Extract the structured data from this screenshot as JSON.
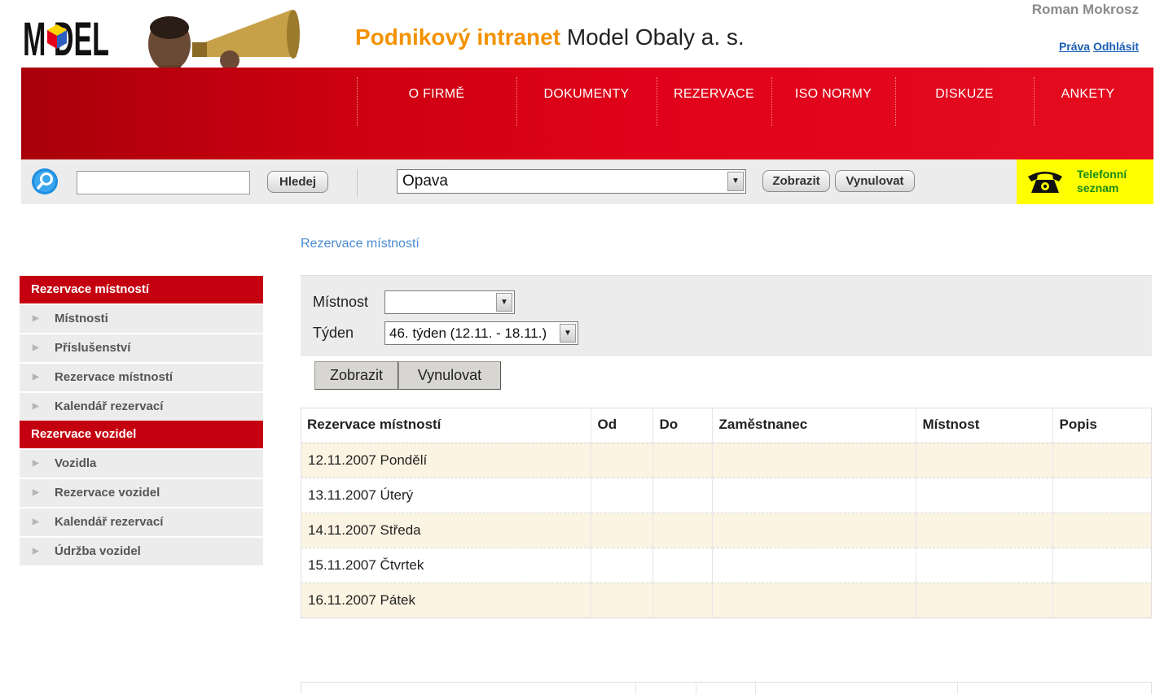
{
  "header": {
    "logo_text": "MODEL",
    "title_part1": "Podnikový intranet",
    "title_part2": "Model Obaly a. s.",
    "user_name": "Roman Mokrosz",
    "link_rights": "Práva",
    "link_logout": "Odhlásit"
  },
  "nav": {
    "items": [
      {
        "label": "O FIRMĚ"
      },
      {
        "label": "DOKUMENTY"
      },
      {
        "label": "REZERVACE"
      },
      {
        "label": "ISO NORMY"
      },
      {
        "label": "DISKUZE"
      },
      {
        "label": "ANKETY"
      }
    ]
  },
  "search": {
    "query": "",
    "button": "Hledej",
    "location_selected": "Opava",
    "show_button": "Zobrazit",
    "reset_button": "Vynulovat",
    "phone_line1": "Telefonní",
    "phone_line2": "seznam"
  },
  "sidebar": {
    "section1_title": "Rezervace místností",
    "section1_items": [
      "Místnosti",
      "Příslušenství",
      "Rezervace místností",
      "Kalendář rezervací"
    ],
    "section2_title": "Rezervace vozidel",
    "section2_items": [
      "Vozidla",
      "Rezervace vozidel",
      "Kalendář rezervací",
      "Údržba vozidel"
    ]
  },
  "main": {
    "breadcrumb": "Rezervace místností",
    "filter": {
      "room_label": "Místnost",
      "room_value": "",
      "week_label": "Týden",
      "week_value": "46. týden (12.11. - 18.11.)",
      "show_button": "Zobrazit",
      "reset_button": "Vynulovat"
    },
    "table": {
      "headers": [
        "Rezervace místností",
        "Od",
        "Do",
        "Zaměstnanec",
        "Místnost",
        "Popis"
      ],
      "rows": [
        "12.11.2007 Pondělí",
        "13.11.2007 Úterý",
        "14.11.2007 Středa",
        "15.11.2007 Čtvrtek",
        "16.11.2007 Pátek"
      ]
    }
  },
  "colors": {
    "nav_red": "#e0021a",
    "title_orange": "#f39200",
    "row_alt": "#fcf4e3",
    "phone_yellow": "#ffff00"
  }
}
